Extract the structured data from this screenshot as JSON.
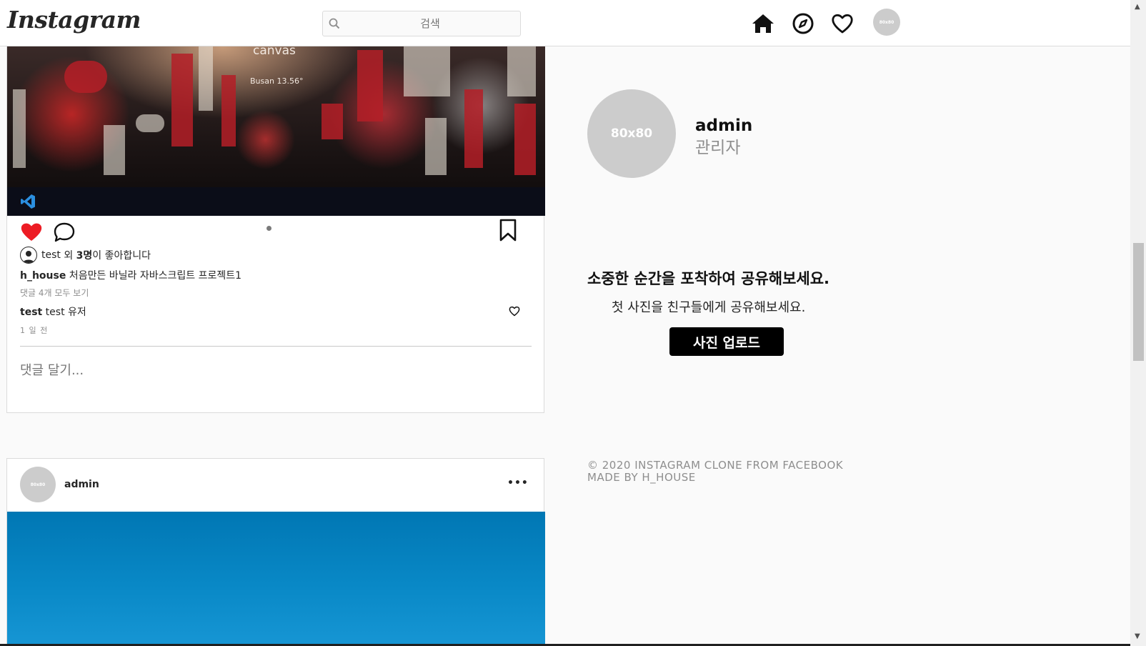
{
  "header": {
    "logo": "Instagram",
    "search_placeholder": "검색",
    "avatar_label": "80x80",
    "icons": [
      "home-icon",
      "explore-icon",
      "heart-icon",
      "profile-avatar"
    ]
  },
  "post1": {
    "photo_caption_top": "canvas",
    "photo_caption_city": "Busan 13.56°",
    "liked_by_user": "test",
    "liked_mid": " 외 ",
    "liked_count": "3명",
    "liked_suffix": "이 좋아합니다",
    "author": "h_house",
    "caption": " 처음만든 바닐라 자바스크립트 프로젝트1",
    "view_comments": "댓글 4개 모두 보기",
    "comment_user": "test",
    "comment_text": " test 유저",
    "time": "1 일 전",
    "comment_placeholder": "댓글 달기..."
  },
  "post2": {
    "avatar_label": "80x80",
    "username": "admin",
    "more": "•••"
  },
  "sidebar": {
    "avatar_label": "80x80",
    "username": "admin",
    "role": "관리자",
    "share_title": "소중한 순간을 포착하여 공유해보세요.",
    "share_sub": "첫 사진을 친구들에게 공유해보세요.",
    "upload_button": "사진 업로드",
    "footer_line1": "© 2020 INSTAGRAM CLONE FROM FACEBOOK",
    "footer_line2": "MADE BY H_HOUSE"
  },
  "colors": {
    "like_red": "#ed1c24",
    "upload_bg": "#000000",
    "avatar_gray": "#cccccc"
  }
}
